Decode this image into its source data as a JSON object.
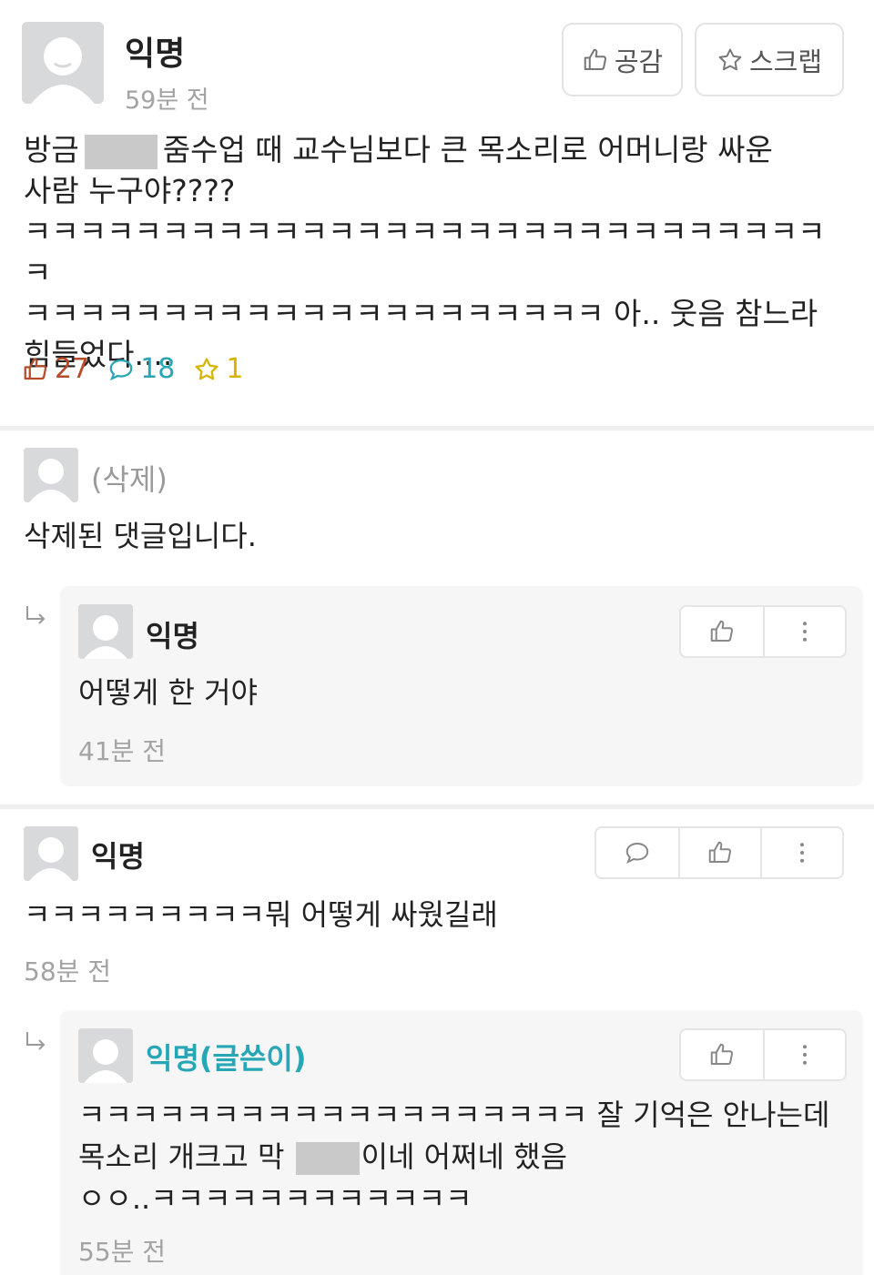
{
  "post": {
    "author": "익명",
    "time": "59분 전",
    "like_button": "공감",
    "scrap_button": "스크랩",
    "body": {
      "line1_a": "방금",
      "line1_b": "줌수업 때 교수님보다 큰 목소리로 어머니랑 싸운",
      "line2": "사람 누구야????",
      "line3": "ㅋㅋㅋㅋㅋㅋㅋㅋㅋㅋㅋㅋㅋㅋㅋㅋㅋㅋㅋㅋㅋㅋㅋㅋㅋㅋㅋㅋㅋㅋ",
      "line4": "ㅋㅋㅋㅋㅋㅋㅋㅋㅋㅋㅋㅋㅋㅋㅋㅋㅋㅋㅋㅋㅋ 아.. 웃음 참느라",
      "line5": "힘들었다...."
    },
    "stats": {
      "likes": "27",
      "comments": "18",
      "scraps": "1"
    },
    "colors": {
      "like": "#b84a2a",
      "comment": "#27a6b5",
      "scrap": "#d8b300"
    }
  },
  "comments": [
    {
      "author": "(삭제)",
      "text": "삭제된 댓글입니다.",
      "reply": {
        "author": "익명",
        "text": "어떻게 한 거야",
        "time": "41분 전"
      }
    },
    {
      "author": "익명",
      "text": "ㅋㅋㅋㅋㅋㅋㅋㅋㅋ뭐 어떻게 싸웠길래",
      "time": "58분 전",
      "reply": {
        "author": "익명(글쓴이)",
        "line1": "ㅋㅋㅋㅋㅋㅋㅋㅋㅋㅋㅋㅋㅋㅋㅋㅋㅋㅋㅋ 잘 기억은 안나는데",
        "line2_a": "목소리 개크고 막",
        "line2_b": "이네 어쩌네 했음",
        "line3": "ㅇㅇ..ㅋㅋㅋㅋㅋㅋㅋㅋㅋㅋㅋㅋ",
        "time": "55분 전"
      }
    }
  ],
  "icons": {
    "like": "thumbs-up-icon",
    "scrap": "star-icon",
    "comment": "speech-bubble-icon",
    "more": "more-vertical-icon",
    "reply": "reply-arrow-icon",
    "avatar": "default-avatar-icon"
  }
}
